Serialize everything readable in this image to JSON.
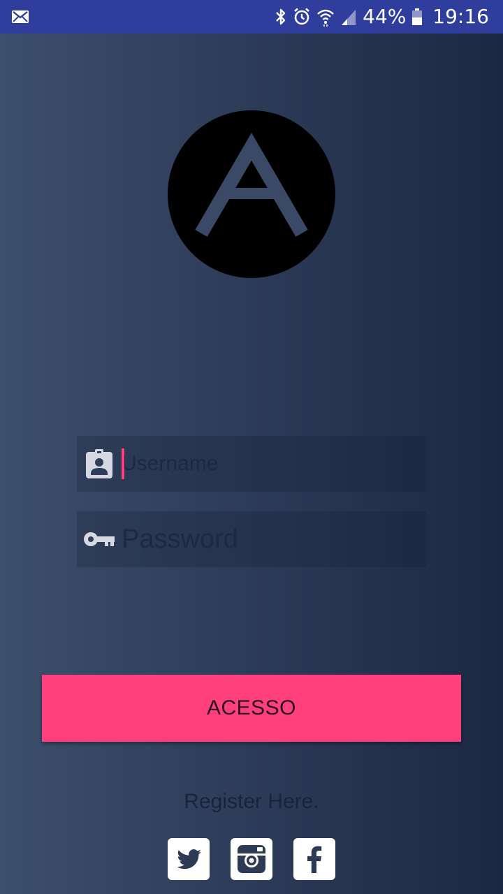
{
  "status_bar": {
    "notification_icon": "mail-icon",
    "icons": [
      "bluetooth-icon",
      "alarm-icon",
      "wifi-icon",
      "signal-icon",
      "battery-icon"
    ],
    "battery_percent": "44%",
    "time": "19:16",
    "background_color": "#2f3e9d"
  },
  "logo": {
    "icon": "letter-a-logo",
    "circle_color": "#000000",
    "letter_color": "#3a4a66"
  },
  "form": {
    "username": {
      "icon": "contact-badge-icon",
      "placeholder": "Username",
      "value": ""
    },
    "password": {
      "icon": "key-icon",
      "placeholder": "Password",
      "value": ""
    }
  },
  "login_button": {
    "label": "ACESSO",
    "color": "#ff407c"
  },
  "register_link": {
    "label": "Register Here."
  },
  "social": [
    {
      "name": "twitter",
      "icon": "twitter-icon"
    },
    {
      "name": "instagram",
      "icon": "instagram-icon"
    },
    {
      "name": "facebook",
      "icon": "facebook-icon"
    }
  ],
  "theme": {
    "accent": "#ff4081",
    "background_start": "#3c4f6b",
    "background_end": "#1c2843"
  }
}
